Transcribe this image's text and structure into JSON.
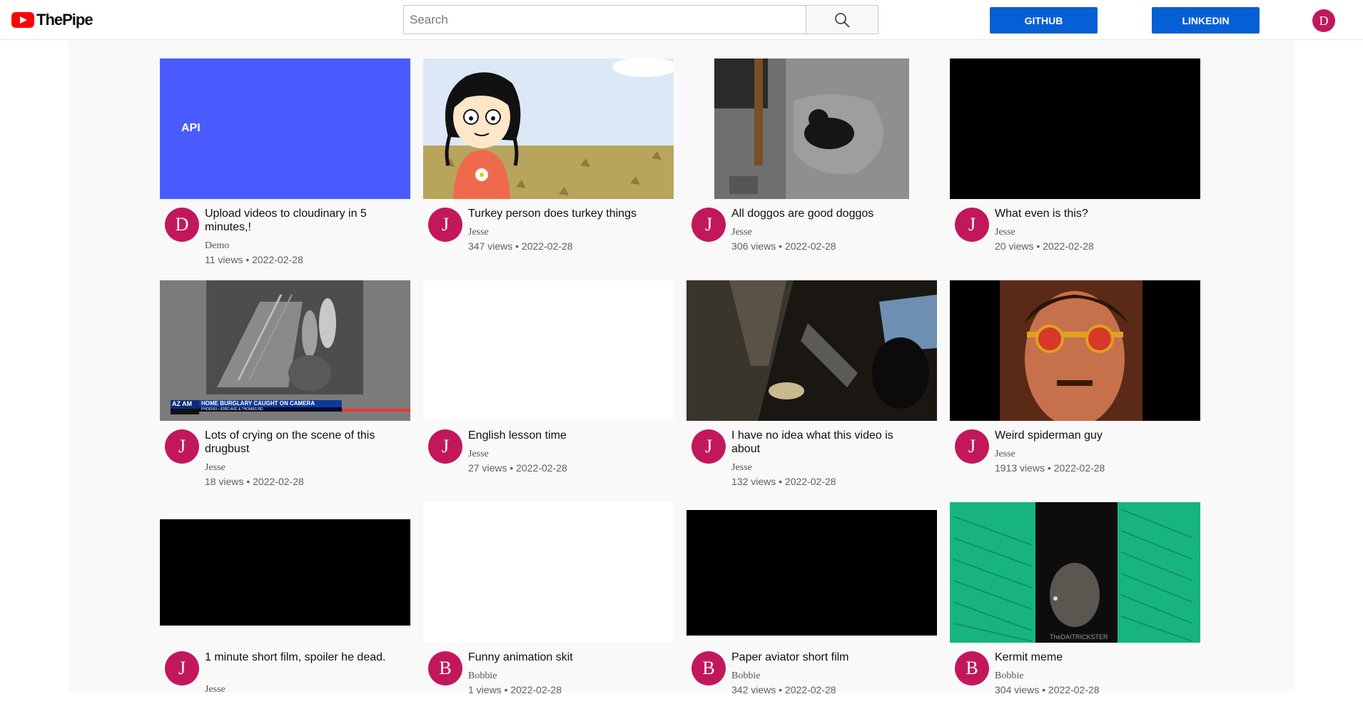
{
  "header": {
    "brand": "ThePipe",
    "search_placeholder": "Search",
    "github_label": "GITHUB",
    "linkedin_label": "LINKEDIN",
    "user_initial": "D"
  },
  "videos": [
    {
      "title": "Upload videos to cloudinary in 5 minutes,!",
      "initial": "D",
      "channel": "Demo",
      "stats": "11 views • 2022-02-28",
      "thumb_text": "API"
    },
    {
      "title": "Turkey person does turkey things",
      "initial": "J",
      "channel": "Jesse",
      "stats": "347 views • 2022-02-28"
    },
    {
      "title": "All doggos are good doggos",
      "initial": "J",
      "channel": "Jesse",
      "stats": "306 views • 2022-02-28"
    },
    {
      "title": "What even is this?",
      "initial": "J",
      "channel": "Jesse",
      "stats": "20 views • 2022-02-28"
    },
    {
      "title": "Lots of crying on the scene of this drugbust",
      "initial": "J",
      "channel": "Jesse",
      "stats": "18 views • 2022-02-28",
      "thumb_text": "HOME BURGLARY CAUGHT ON CAMERA",
      "thumb_subtext": "PHOENIX • 83RD AVE & THOMAS RD",
      "thumb_logo": "AZ AM"
    },
    {
      "title": "English lesson time",
      "initial": "J",
      "channel": "Jesse",
      "stats": "27 views • 2022-02-28"
    },
    {
      "title": "I have no idea what this video is about",
      "initial": "J",
      "channel": "Jesse",
      "stats": "132 views • 2022-02-28"
    },
    {
      "title": "Weird spiderman guy",
      "initial": "J",
      "channel": "Jesse",
      "stats": "1913 views • 2022-02-28"
    },
    {
      "title": "1 minute short film, spoiler he dead.",
      "initial": "J",
      "channel": "Jesse",
      "stats": ""
    },
    {
      "title": "Funny animation skit",
      "initial": "B",
      "channel": "Bobbie",
      "stats": "1 views • 2022-02-28"
    },
    {
      "title": "Paper aviator short film",
      "initial": "B",
      "channel": "Bobbie",
      "stats": "342 views • 2022-02-28"
    },
    {
      "title": "Kermit meme",
      "initial": "B",
      "channel": "Bobbie",
      "stats": "304 views • 2022-02-28",
      "thumb_text": "TheDAITRICKSTER"
    }
  ]
}
